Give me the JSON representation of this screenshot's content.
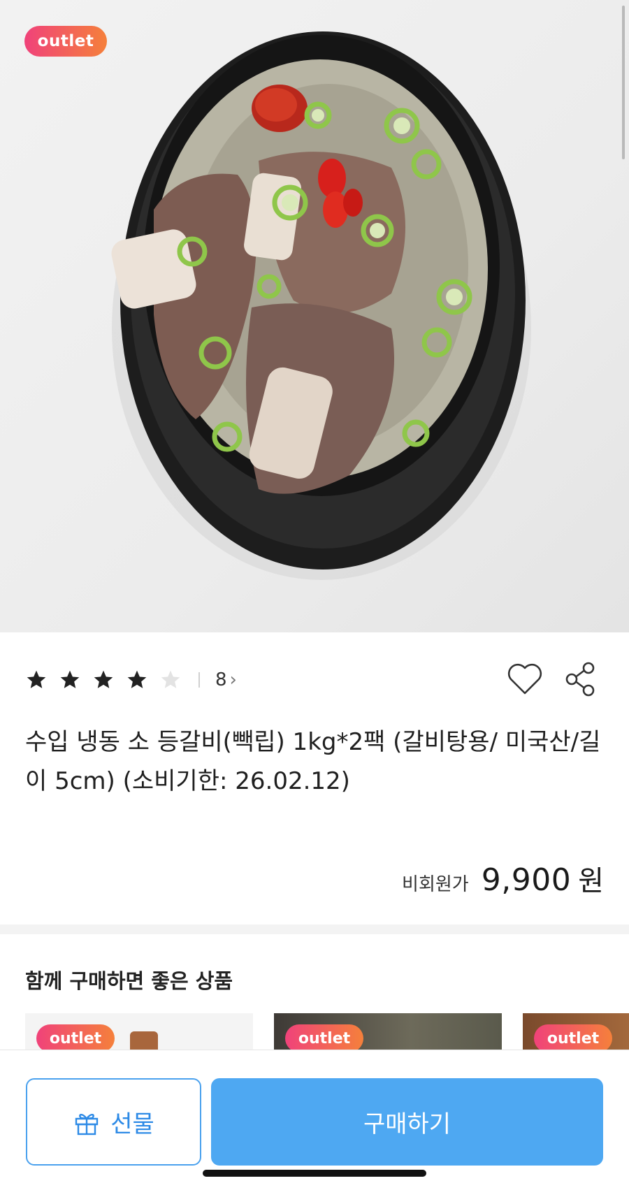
{
  "hero": {
    "badge_label": "outlet",
    "image_desc_icon": "galbitang-photo"
  },
  "product": {
    "rating": 4,
    "rating_max": 5,
    "review_count": "8",
    "review_chevron": "›",
    "title": "수입 냉동 소 등갈비(빽립) 1kg*2팩 (갈비탕용/ 미국산/길이 5cm) (소비기한: 26.02.12)",
    "price_label": "비회원가",
    "price_value": "9,900",
    "price_unit": "원"
  },
  "recommend": {
    "title": "함께 구매하면 좋은 상품",
    "cards": [
      {
        "badge": "outlet"
      },
      {
        "badge": "outlet"
      },
      {
        "badge": "outlet"
      }
    ]
  },
  "bottom_bar": {
    "gift_label": "선물",
    "buy_label": "구매하기"
  },
  "colors": {
    "accent_blue": "#4ea8f2",
    "gift_blue": "#2d8ae6",
    "badge_start": "#f0427a",
    "badge_end": "#f5803b"
  }
}
